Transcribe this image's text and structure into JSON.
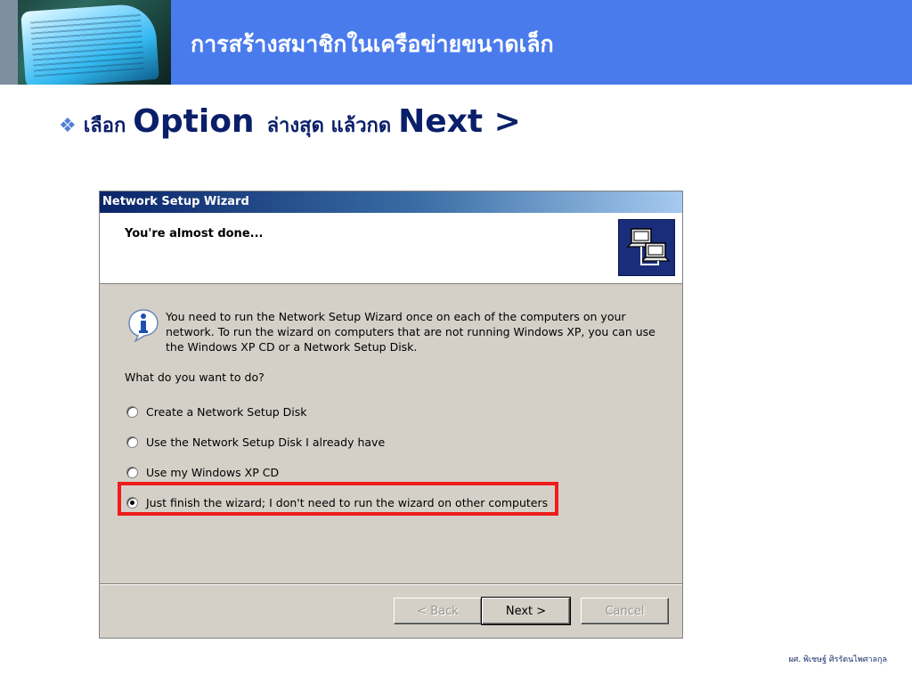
{
  "slide": {
    "title": "การสร้างสมาชิกในเครือข่ายขนาดเล็ก",
    "bullet": {
      "marker": "❖",
      "text_1": "เลือก",
      "keyword_1": "Option",
      "text_2": "ล่างสุด แล้วกด",
      "keyword_2": "Next >"
    },
    "footer": "ผศ. พิเชษฐ์ ศิรรัตนไพศาลกุล"
  },
  "dialog": {
    "window_title": "Network Setup Wizard",
    "heading": "You're almost done...",
    "info_text": "You need to run the Network Setup Wizard once on each of the computers on your network. To run the wizard on computers that are not running Windows XP, you can use the Windows XP CD or a Network Setup Disk.",
    "question": "What do you want to do?",
    "options": [
      {
        "label": "Create a Network Setup Disk",
        "selected": false
      },
      {
        "label": "Use the Network Setup Disk I already have",
        "selected": false
      },
      {
        "label": "Use my Windows XP CD",
        "selected": false
      },
      {
        "label": "Just finish the wizard; I don't need to run the wizard on other computers",
        "selected": true
      }
    ],
    "buttons": {
      "back": "< Back",
      "next": "Next >",
      "cancel": "Cancel"
    },
    "highlight_color": "#ee1c1c"
  },
  "colors": {
    "header_blue": "#4a7bec",
    "title_bar_start": "#0a246a",
    "dialog_face": "#d4d0c8"
  }
}
